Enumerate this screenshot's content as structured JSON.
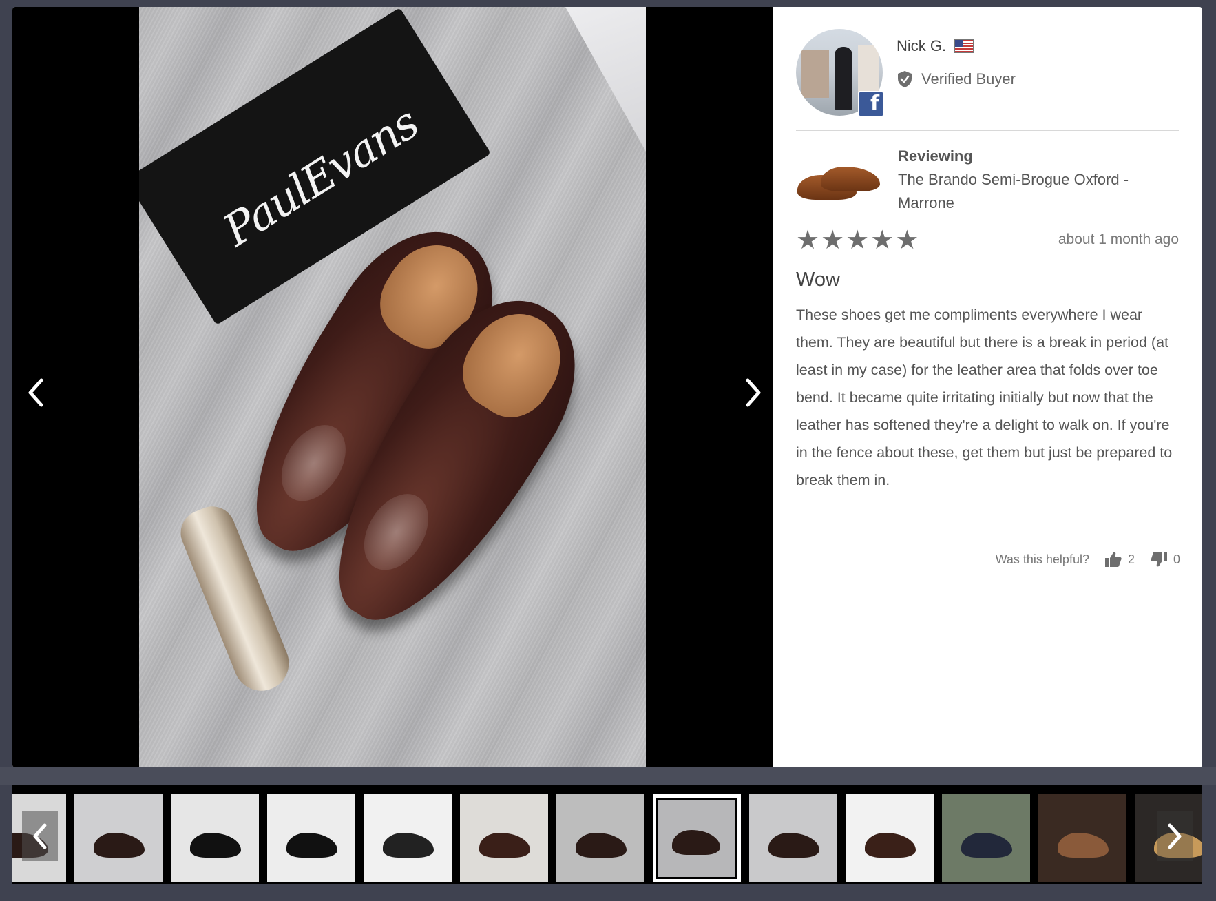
{
  "reviewer": {
    "name": "Nick G.",
    "verified_label": "Verified Buyer",
    "social_badge": "f"
  },
  "product": {
    "reviewing_label": "Reviewing",
    "name": "The Brando Semi-Brogue Oxford - Marrone"
  },
  "review": {
    "rating": 5,
    "stars": "★★★★★",
    "date": "about 1 month ago",
    "title": "Wow",
    "body": "These shoes get me compliments everywhere I wear them. They are beautiful but there is a break in period (at least in my case) for the leather area that folds over toe bend. It became quite irritating initially but now that the leather has softened they're a delight to walk on. If you're in the fence about these, get them but just be prepared to break them in."
  },
  "helpful": {
    "question": "Was this helpful?",
    "up_count": "2",
    "down_count": "0"
  },
  "gallery": {
    "active_index": 6,
    "thumbnail_count": 13
  },
  "colors": {
    "backdrop": "#3f4250",
    "facebook": "#3b5998",
    "star": "#6e6e6e"
  }
}
